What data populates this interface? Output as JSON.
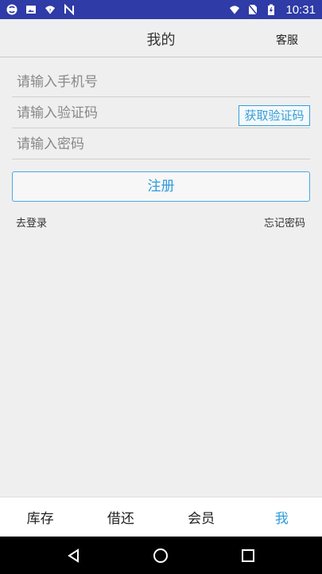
{
  "status_bar": {
    "time": "10:31",
    "icons": [
      "s-logo-icon",
      "image-icon",
      "wifi-question-icon",
      "n-logo-icon",
      "wifi-icon",
      "no-sim-icon",
      "battery-charging-icon"
    ],
    "bg_color": "#2f3ba6"
  },
  "header": {
    "title": "我的",
    "service_label": "客服"
  },
  "form": {
    "phone_placeholder": "请输入手机号",
    "code_placeholder": "请输入验证码",
    "get_code_label": "获取验证码",
    "password_placeholder": "请输入密码",
    "register_label": "注册",
    "login_link": "去登录",
    "forgot_link": "忘记密码",
    "accent_color": "#2f9bdc"
  },
  "tabs": [
    {
      "label": "库存",
      "active": false
    },
    {
      "label": "借还",
      "active": false
    },
    {
      "label": "会员",
      "active": false
    },
    {
      "label": "我",
      "active": true
    }
  ],
  "nav_bar": {
    "icons": [
      "back-icon",
      "home-icon",
      "recents-icon"
    ]
  }
}
